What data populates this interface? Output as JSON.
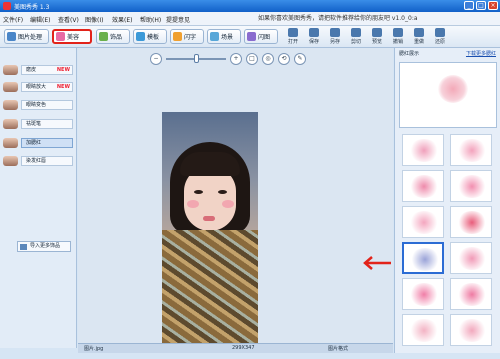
{
  "app": {
    "title": "美图秀秀 1.3"
  },
  "menu": {
    "items": [
      "文件(F)",
      "编辑(E)",
      "查看(V)",
      "图像(I)",
      "效果(E)",
      "帮助(H)",
      "提提意见"
    ]
  },
  "promo": "如果你喜欢美图秀秀，请把软件推荐给你的朋友吧 v1.0_0:a",
  "tabs": [
    {
      "label": "图片处理",
      "active": false,
      "color": "#4a86c8"
    },
    {
      "label": "美容",
      "active": true,
      "color": "#e86aa4"
    },
    {
      "label": "饰品",
      "active": false,
      "color": "#6ab04c"
    },
    {
      "label": "模板",
      "active": false,
      "color": "#3c9ad8"
    },
    {
      "label": "闪字",
      "active": false,
      "color": "#f0a030"
    },
    {
      "label": "场景",
      "active": false,
      "color": "#58a7d8"
    },
    {
      "label": "闪图",
      "active": false,
      "color": "#8a6ccf"
    }
  ],
  "tools": [
    "打开",
    "保存",
    "另存",
    "剪切",
    "预览",
    "撤销",
    "重做",
    "还原"
  ],
  "left_items": [
    {
      "label": "磨皮",
      "new": true,
      "badge": "NEW"
    },
    {
      "label": "眼睛放大",
      "new": true,
      "badge": "NEW"
    },
    {
      "label": "眼睛变色",
      "new": false,
      "badge": ""
    },
    {
      "label": "祛斑笔",
      "new": false,
      "badge": ""
    },
    {
      "label": "加腮红",
      "new": false,
      "badge": "",
      "selected": true
    },
    {
      "label": "染发红唇",
      "new": false,
      "badge": ""
    }
  ],
  "more_button": "导入更多饰品",
  "zoom": {
    "minus": "−",
    "plus": "+",
    "fit": "□",
    "actual": "◎",
    "rotate": "⟲",
    "pen": "✎",
    "level": 0.72
  },
  "status": {
    "left": "图片.jpg",
    "middle": "299X347",
    "right": "图片格式"
  },
  "right_panel": {
    "title": "腮红展示",
    "link": "下载更多腮红",
    "swatches": [
      {
        "color": "#f0a0bb"
      },
      {
        "color": "#f3a2bc"
      },
      {
        "color": "#ee8aab"
      },
      {
        "color": "#f28fb0"
      },
      {
        "color": "#f4a6bf"
      },
      {
        "color": "#e85c7a"
      },
      {
        "color": "#9aa3d8",
        "selected": true
      },
      {
        "color": "#f19ab7"
      },
      {
        "color": "#f07ea7"
      },
      {
        "color": "#ee7aa2"
      },
      {
        "color": "#f3b3c4"
      },
      {
        "color": "#f2a8bd"
      }
    ]
  },
  "colors": {
    "accent_red": "#e2231a",
    "selected_blue": "#2b6cd4"
  }
}
